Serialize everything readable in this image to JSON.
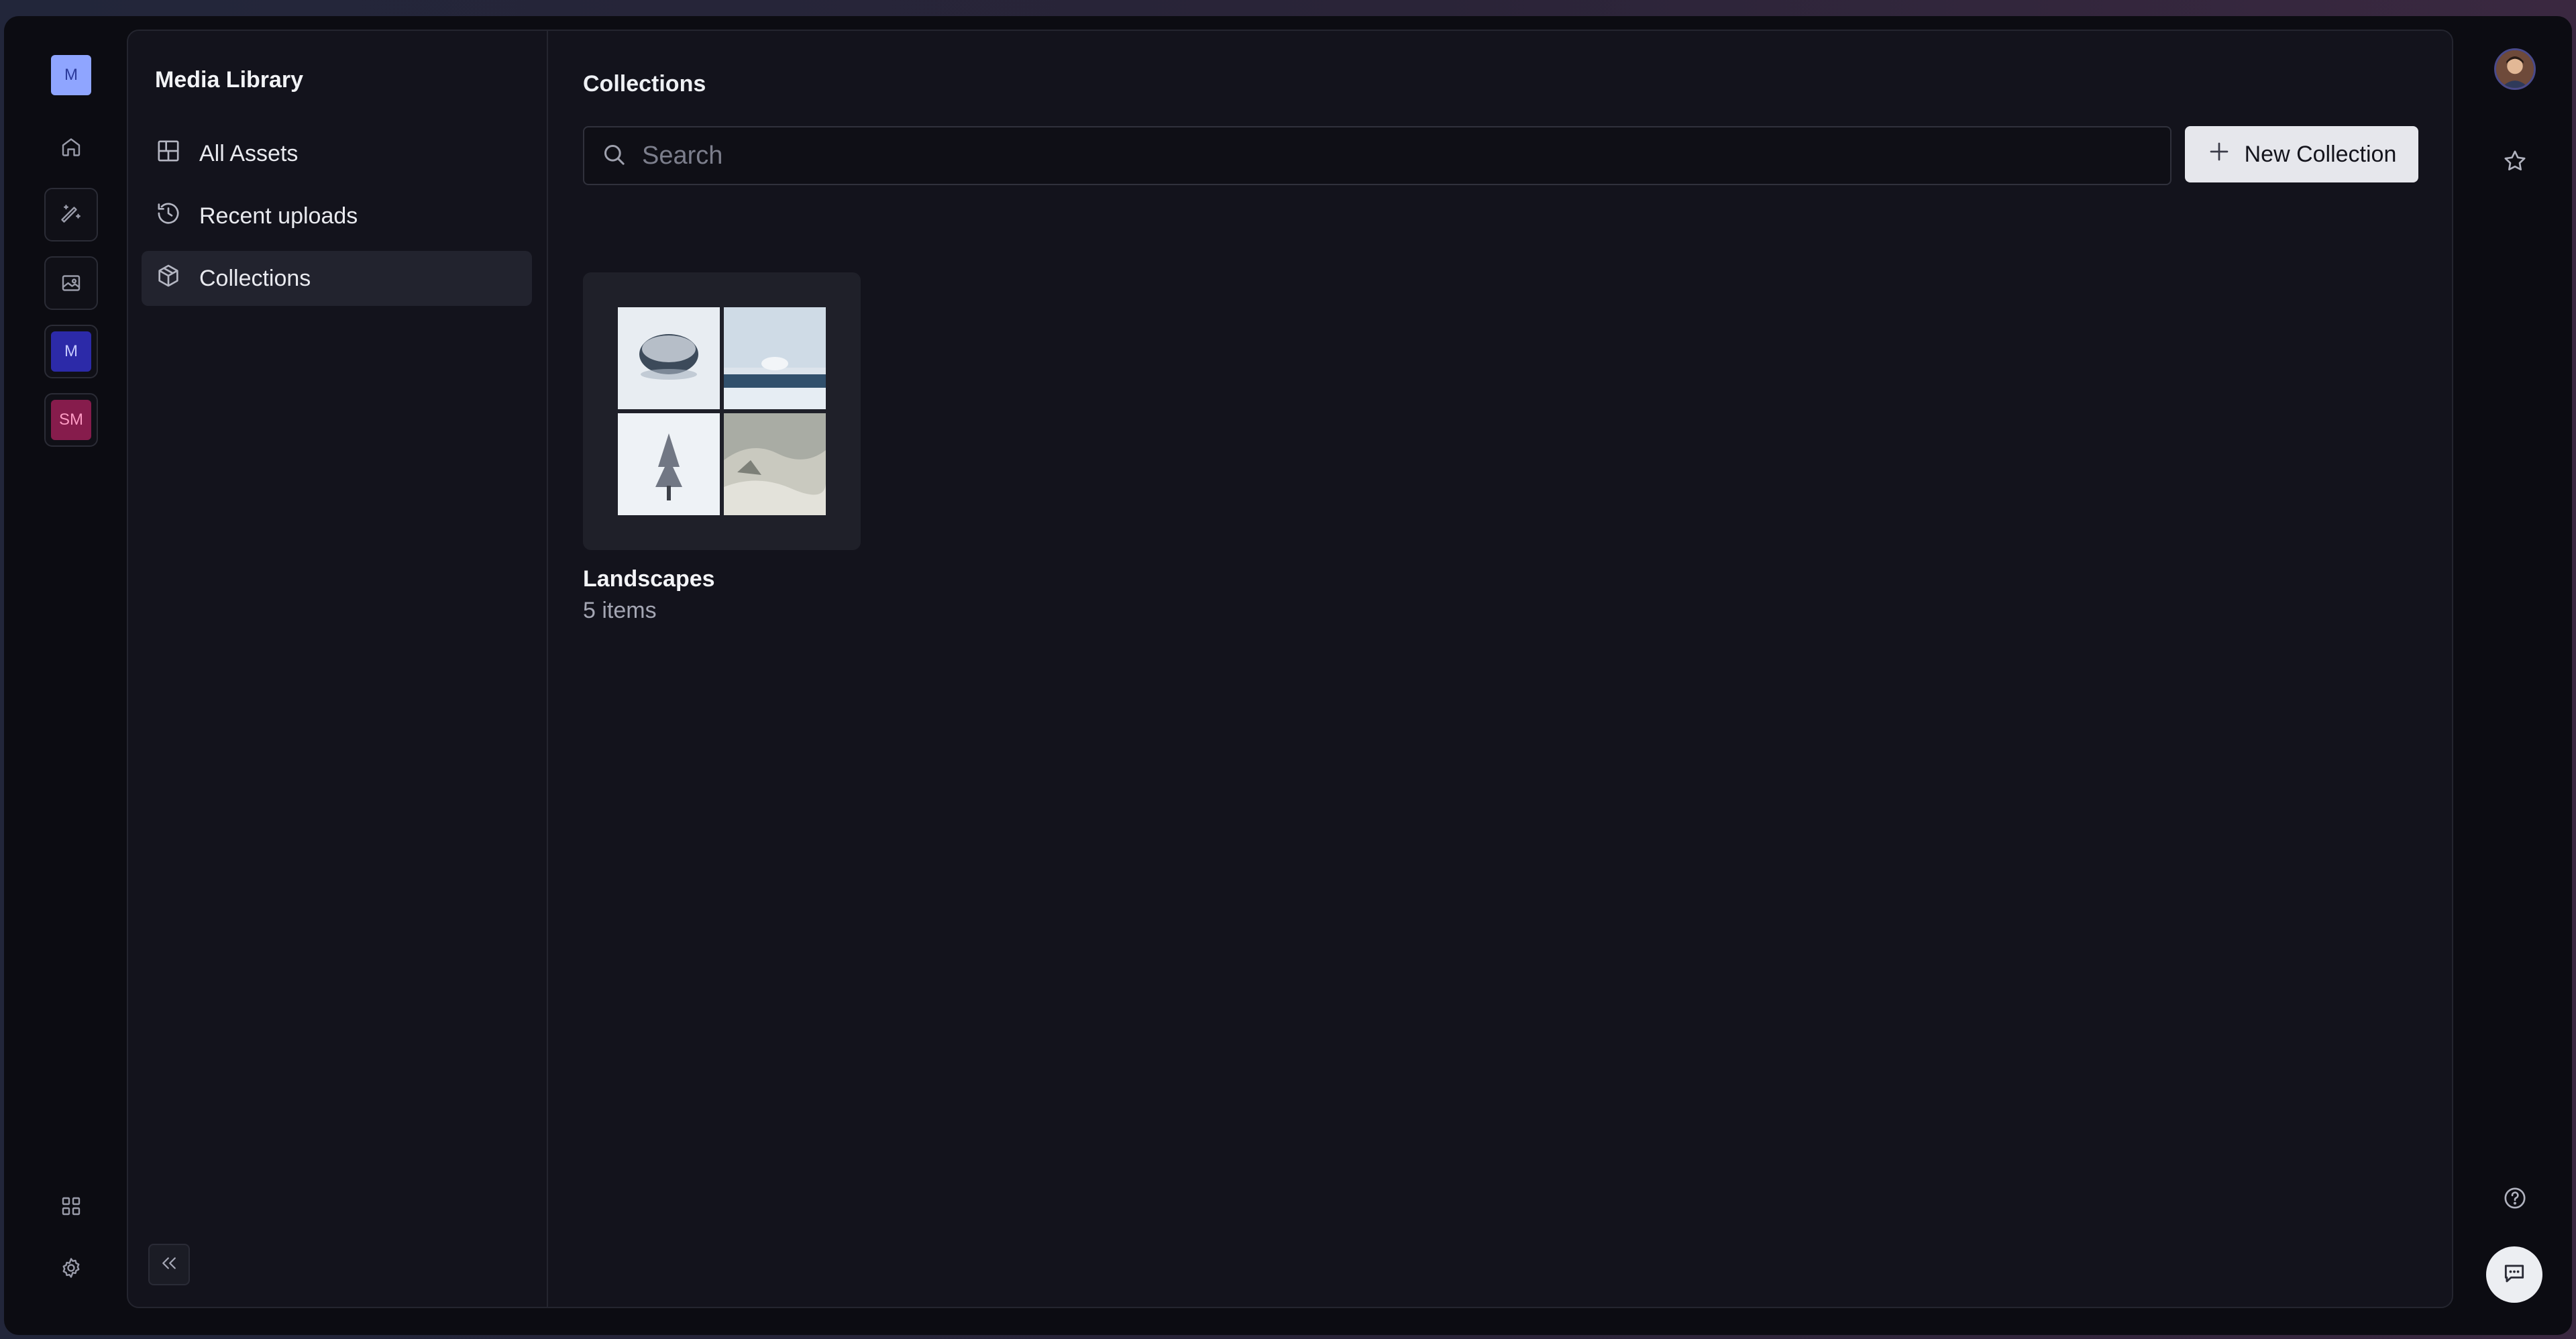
{
  "workspace": {
    "badges": [
      {
        "label": "M"
      },
      {
        "label": "M"
      },
      {
        "label": "SM"
      }
    ]
  },
  "sidebar": {
    "title": "Media Library",
    "items": [
      {
        "label": "All Assets",
        "icon": "layout-grid-icon",
        "active": false
      },
      {
        "label": "Recent uploads",
        "icon": "history-icon",
        "active": false
      },
      {
        "label": "Collections",
        "icon": "package-icon",
        "active": true
      }
    ]
  },
  "main": {
    "title": "Collections",
    "search": {
      "placeholder": "Search",
      "value": ""
    },
    "new_button_label": "New Collection",
    "collections": [
      {
        "name": "Landscapes",
        "count": "5 items"
      }
    ]
  },
  "colors": {
    "background": "#0c0c12",
    "panel": "#13131c",
    "active_nav": "#22232e",
    "badge_light": "#8fa5ff",
    "badge_indigo": "#2c2aa8",
    "badge_rose": "#861c4c"
  }
}
